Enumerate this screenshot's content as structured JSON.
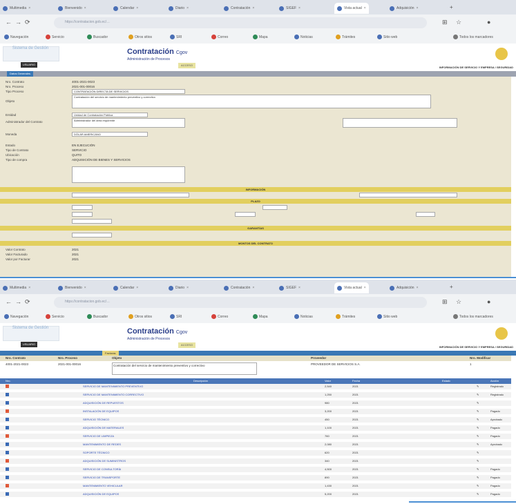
{
  "browser": {
    "tabs": [
      {
        "label": "Multimedia"
      },
      {
        "label": "Bienvenido"
      },
      {
        "label": "Calendar"
      },
      {
        "label": "Diario"
      },
      {
        "label": "Contratación"
      },
      {
        "label": "SIGEF"
      },
      {
        "label": "Vista actual",
        "active": true
      },
      {
        "label": "Adquisición"
      }
    ],
    "url": "https://contratacion.gob.ec/…",
    "bookmarks": [
      "Navegación",
      "Servicio",
      "Buscador",
      "Otros sitios",
      "SRI",
      "Correo",
      "Mapa",
      "Noticias",
      "Trámites",
      "Sitio web",
      "Todos los marcadores"
    ]
  },
  "site": {
    "logo_text": "Sistema de Gestión",
    "title": "Contratación",
    "title_suffix": "Cgov",
    "subtitle": "Administración de Procesos",
    "login_btn": "USUARIO",
    "small_btn": "ACCESO",
    "section_name": "INFORMACIÓN DE SERVICIO Y EMPRESA / SEGURIDAD"
  },
  "form": {
    "tab_label": "Datos Generales",
    "fields": [
      {
        "label": "Nro. Contrato",
        "value": "4001-2021-0023"
      },
      {
        "label": "Nro. Proceso",
        "value": "2021-001-00016"
      },
      {
        "label": "Tipo Proceso",
        "value": "CONTRATACIÓN DIRECTA DE SERVICIOS"
      },
      {
        "label": "Objeto",
        "value": "Contratación del servicio de mantenimiento preventivo y correctivo"
      },
      {
        "label": "Entidad",
        "value": "Unidad de Contratación Pública"
      },
      {
        "label": "Administrador del Contrato",
        "value": "Administrador del área requirente"
      },
      {
        "label": "Moneda",
        "value": "DÓLAR AMERICANO"
      },
      {
        "label": "Estado",
        "value": "EN EJECUCIÓN"
      },
      {
        "label": "Tipo de Contrato",
        "value": "SERVICIO"
      },
      {
        "label": "Ubicación",
        "value": "QUITO"
      },
      {
        "label": "Tipo de compra",
        "value": "ADQUISICIÓN DE BIENES Y SERVICIOS"
      }
    ],
    "sections": {
      "s1": "INFORMACIÓN",
      "s2": "PLAZO",
      "s3": "GARANTÍAS",
      "s4": "MONTOS DEL CONTRATO"
    },
    "amounts": [
      {
        "label": "Valor Contrato",
        "value": "2021"
      },
      {
        "label": "Valor Facturado",
        "value": "2021"
      },
      {
        "label": "Valor por Facturar",
        "value": "2021"
      }
    ]
  },
  "table": {
    "tab_label": "Facturas",
    "info_headers": [
      "Nro. Contrato",
      "Nro. Proceso",
      "Objeto",
      "Proveedor",
      "Nro. Modificar"
    ],
    "info_values": [
      "4001-2021-0023",
      "2021-001-00016",
      "Contratación del servicio de mantenimiento preventivo y correctivo",
      "PROVEEDOR DE SERVICIOS S.A.",
      "1"
    ],
    "columns": [
      "Nro.",
      "Descripción",
      "Valor",
      "Fecha",
      "Estado",
      "Acción"
    ],
    "rows": [
      {
        "desc": "SERVICIO DE MANTENIMIENTO PREVENTIVO",
        "value": "2,540",
        "date": "2021",
        "status": "Registrado"
      },
      {
        "desc": "SERVICIO DE MANTENIMIENTO CORRECTIVO",
        "value": "1,250",
        "date": "2021",
        "status": "Registrado"
      },
      {
        "desc": "ADQUISICIÓN DE REPUESTOS",
        "value": "980",
        "date": "2021",
        "status": ""
      },
      {
        "desc": "INSTALACIÓN DE EQUIPOS",
        "value": "3,200",
        "date": "2021",
        "status": "Pagado"
      },
      {
        "desc": "SERVICIO TÉCNICO",
        "value": "450",
        "date": "2021",
        "status": "Aprobado"
      },
      {
        "desc": "ADQUISICIÓN DE MATERIALES",
        "value": "1,100",
        "date": "2021",
        "status": "Pagado"
      },
      {
        "desc": "SERVICIO DE LIMPIEZA",
        "value": "760",
        "date": "2021",
        "status": "Pagado"
      },
      {
        "desc": "MANTENIMIENTO DE REDES",
        "value": "2,080",
        "date": "2021",
        "status": "Aprobado"
      },
      {
        "desc": "SOPORTE TÉCNICO",
        "value": "620",
        "date": "2021",
        "status": ""
      },
      {
        "desc": "ADQUISICIÓN DE SUMINISTROS",
        "value": "340",
        "date": "2021",
        "status": ""
      },
      {
        "desc": "SERVICIO DE CONSULTORÍA",
        "value": "4,500",
        "date": "2021",
        "status": "Pagado"
      },
      {
        "desc": "SERVICIO DE TRANSPORTE",
        "value": "890",
        "date": "2021",
        "status": "Pagado"
      },
      {
        "desc": "MANTENIMIENTO VEHICULAR",
        "value": "1,430",
        "date": "2021",
        "status": "Pagado"
      },
      {
        "desc": "ADQUISICIÓN DE EQUIPOS",
        "value": "5,200",
        "date": "2021",
        "status": "Pagado"
      }
    ]
  }
}
